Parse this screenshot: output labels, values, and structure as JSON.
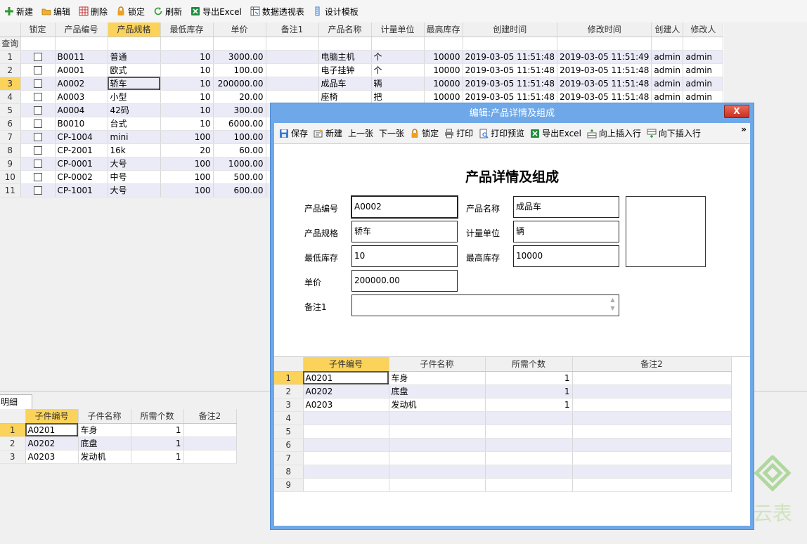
{
  "toolbar": {
    "new": "新建",
    "edit": "编辑",
    "delete": "删除",
    "lock": "锁定",
    "refresh": "刷新",
    "export": "导出Excel",
    "pivot": "数据透视表",
    "template": "设计模板"
  },
  "main_grid": {
    "query_label": "查询",
    "columns": [
      "锁定",
      "产品编号",
      "产品规格",
      "最低库存",
      "单价",
      "备注1",
      "产品名称",
      "计量单位",
      "最高库存",
      "创建时间",
      "修改时间",
      "创建人",
      "修改人"
    ],
    "rows": [
      {
        "n": "1",
        "code": "B0011",
        "spec": "普通",
        "min": "10",
        "price": "3000.00",
        "memo": "",
        "name": "电脑主机",
        "unit": "个",
        "max": "10000",
        "created": "2019-03-05 11:51:48",
        "modified": "2019-03-05 11:51:49",
        "creator": "admin",
        "modifier": "admin"
      },
      {
        "n": "2",
        "code": "A0001",
        "spec": "欧式",
        "min": "10",
        "price": "100.00",
        "memo": "",
        "name": "电子挂钟",
        "unit": "个",
        "max": "10000",
        "created": "2019-03-05 11:51:48",
        "modified": "2019-03-05 11:51:48",
        "creator": "admin",
        "modifier": "admin"
      },
      {
        "n": "3",
        "code": "A0002",
        "spec": "轿车",
        "min": "10",
        "price": "200000.00",
        "memo": "",
        "name": "成品车",
        "unit": "辆",
        "max": "10000",
        "created": "2019-03-05 11:51:48",
        "modified": "2019-03-05 11:51:48",
        "creator": "admin",
        "modifier": "admin"
      },
      {
        "n": "4",
        "code": "A0003",
        "spec": "小型",
        "min": "10",
        "price": "20.00",
        "memo": "",
        "name": "座椅",
        "unit": "把",
        "max": "10000",
        "created": "2019-03-05 11:51:48",
        "modified": "2019-03-05 11:51:48",
        "creator": "admin",
        "modifier": "admin"
      },
      {
        "n": "5",
        "code": "A0004",
        "spec": "42码",
        "min": "10",
        "price": "300.00"
      },
      {
        "n": "6",
        "code": "B0010",
        "spec": "台式",
        "min": "10",
        "price": "6000.00"
      },
      {
        "n": "7",
        "code": "CP-1004",
        "spec": "mini",
        "min": "100",
        "price": "100.00"
      },
      {
        "n": "8",
        "code": "CP-2001",
        "spec": "16k",
        "min": "20",
        "price": "60.00"
      },
      {
        "n": "9",
        "code": "CP-0001",
        "spec": "大号",
        "min": "100",
        "price": "1000.00"
      },
      {
        "n": "10",
        "code": "CP-0002",
        "spec": "中号",
        "min": "100",
        "price": "500.00"
      },
      {
        "n": "11",
        "code": "CP-1001",
        "spec": "大号",
        "min": "100",
        "price": "600.00"
      }
    ]
  },
  "detail": {
    "tab_label": "明细",
    "columns": [
      "子件编号",
      "子件名称",
      "所需个数",
      "备注2"
    ],
    "rows": [
      {
        "n": "1",
        "code": "A0201",
        "name": "车身",
        "qty": "1",
        "memo": ""
      },
      {
        "n": "2",
        "code": "A0202",
        "name": "底盘",
        "qty": "1",
        "memo": ""
      },
      {
        "n": "3",
        "code": "A0203",
        "name": "发动机",
        "qty": "1",
        "memo": ""
      }
    ]
  },
  "dialog": {
    "title": "编辑:产品详情及组成",
    "close_label": "X",
    "more_label": "»",
    "toolbar": {
      "save": "保存",
      "new": "新建",
      "prev": "上一张",
      "next": "下一张",
      "lock": "锁定",
      "print": "打印",
      "preview": "打印预览",
      "export": "导出Excel",
      "insert_above": "向上插入行",
      "insert_below": "向下插入行"
    },
    "form_title": "产品详情及组成",
    "form": {
      "code_label": "产品编号",
      "code": "A0002",
      "name_label": "产品名称",
      "name": "成品车",
      "spec_label": "产品规格",
      "spec": "轿车",
      "unit_label": "计量单位",
      "unit": "辆",
      "min_label": "最低库存",
      "min": "10",
      "max_label": "最高库存",
      "max": "10000",
      "price_label": "单价",
      "price": "200000.00",
      "memo_label": "备注1",
      "memo": ""
    },
    "grid": {
      "columns": [
        "子件编号",
        "子件名称",
        "所需个数",
        "备注2"
      ],
      "rows": [
        {
          "n": "1",
          "code": "A0201",
          "name": "车身",
          "qty": "1"
        },
        {
          "n": "2",
          "code": "A0202",
          "name": "底盘",
          "qty": "1"
        },
        {
          "n": "3",
          "code": "A0203",
          "name": "发动机",
          "qty": "1"
        },
        {
          "n": "4"
        },
        {
          "n": "5"
        },
        {
          "n": "6"
        },
        {
          "n": "7"
        },
        {
          "n": "8"
        },
        {
          "n": "9"
        }
      ]
    }
  },
  "watermark": {
    "text": "云表",
    "color": "#6ab04c"
  }
}
